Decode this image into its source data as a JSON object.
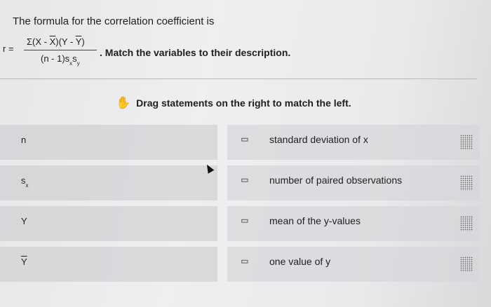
{
  "header": {
    "title": "The formula for the correlation coefficient is",
    "formula": {
      "lhs": "r =",
      "numerator_parts": [
        "Σ(X - ",
        "X",
        ")(Y - ",
        "Y",
        ")"
      ],
      "denominator_parts": [
        "(n - 1)s",
        "x",
        "s",
        "y"
      ]
    },
    "match_text": ". Match the variables to their description."
  },
  "instruction": {
    "icon": "hand-icon",
    "text": "Drag statements on the right to match the left."
  },
  "rows": [
    {
      "left": "n",
      "left_sub": "",
      "right": "standard deviation of x"
    },
    {
      "left": "s",
      "left_sub": "x",
      "right": "number of paired observations"
    },
    {
      "left": "Y",
      "left_sub": "",
      "right": "mean of the y-values"
    },
    {
      "left": "Y",
      "left_sub": "",
      "left_overline": true,
      "right": "one value of y"
    }
  ],
  "icons": {
    "link": "link-icon",
    "grip": "grip-icon",
    "cursor": "cursor-icon"
  }
}
